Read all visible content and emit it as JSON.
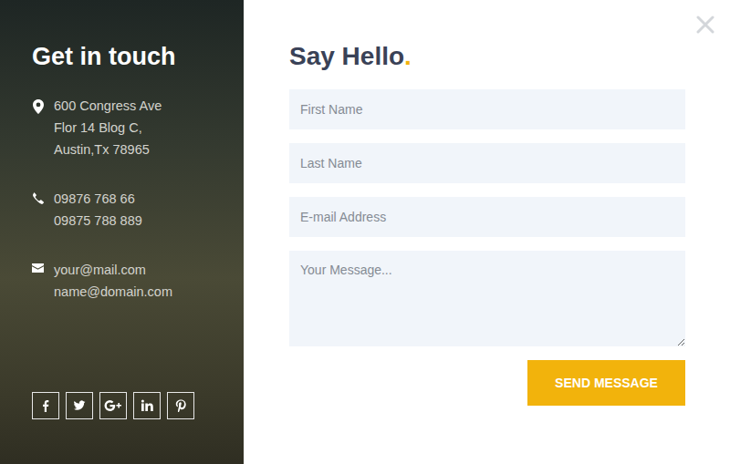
{
  "contact_panel": {
    "title": "Get in touch",
    "contacts": [
      {
        "kind": "address",
        "lines": [
          "600 Congress Ave",
          "Flor 14 Blog C,",
          "Austin,Tx 78965"
        ]
      },
      {
        "kind": "phone",
        "lines": [
          "09876 768 66",
          "09875 788 889"
        ]
      },
      {
        "kind": "mail",
        "lines": [
          "your@mail.com",
          "name@domain.com"
        ]
      }
    ],
    "social": [
      {
        "kind": "facebook"
      },
      {
        "kind": "twitter"
      },
      {
        "kind": "google-plus"
      },
      {
        "kind": "linkedin"
      },
      {
        "kind": "pinterest"
      }
    ]
  },
  "form": {
    "title": "Say Hello",
    "title_accent": ".",
    "fields": [
      {
        "kind": "input",
        "placeholder": "First Name"
      },
      {
        "kind": "input",
        "placeholder": "Last Name"
      },
      {
        "kind": "input",
        "placeholder": "E-mail Address"
      },
      {
        "kind": "textarea",
        "placeholder": "Your Message..."
      }
    ],
    "submit": "SEND MESSAGE"
  }
}
